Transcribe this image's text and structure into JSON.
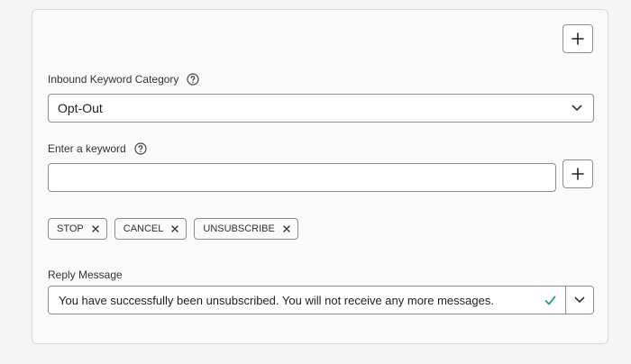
{
  "form": {
    "add_section_button": {
      "icon": "plus-icon"
    },
    "category": {
      "label": "Inbound Keyword Category",
      "selected": "Opt-Out",
      "help_icon": "help-circle-icon"
    },
    "keyword": {
      "label": "Enter a keyword",
      "value": "",
      "placeholder": "",
      "help_icon": "help-circle-icon",
      "add_icon": "plus-icon"
    },
    "keywords": [
      {
        "text": "STOP"
      },
      {
        "text": "CANCEL"
      },
      {
        "text": "UNSUBSCRIBE"
      }
    ],
    "reply": {
      "label": "Reply Message",
      "value": "You have successfully been unsubscribed. You will not receive any more messages.",
      "status_icon": "checkmark-icon",
      "status_color": "#2d9d78"
    }
  }
}
